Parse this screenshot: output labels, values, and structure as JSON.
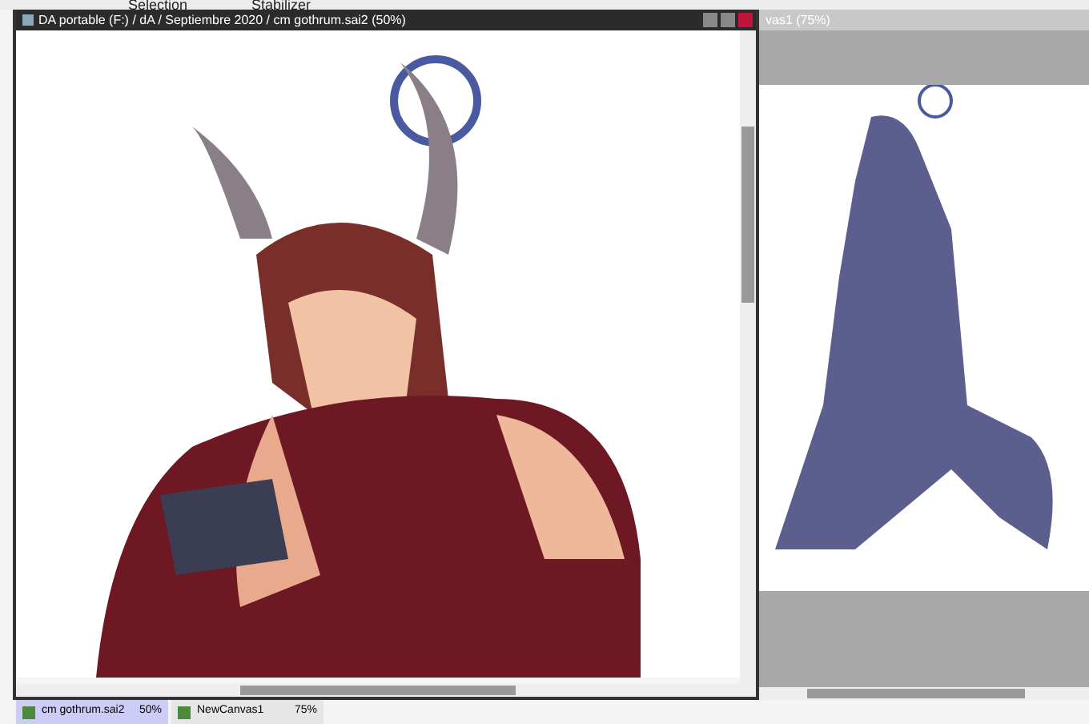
{
  "toolbar": {
    "selection_label": "Selection",
    "stabilizer_label": "Stabilizer"
  },
  "windows": [
    {
      "title": "DA portable (F:) / dA / Septiembre 2020 / cm gothrum.sai2 (50%)",
      "active": true
    },
    {
      "title": "vas1 (75%)",
      "active": false
    }
  ],
  "tabs": [
    {
      "name": "cm gothrum.sai2",
      "zoom": "50%",
      "selected": true
    },
    {
      "name": "NewCanvas1",
      "zoom": "75%",
      "selected": false
    }
  ]
}
